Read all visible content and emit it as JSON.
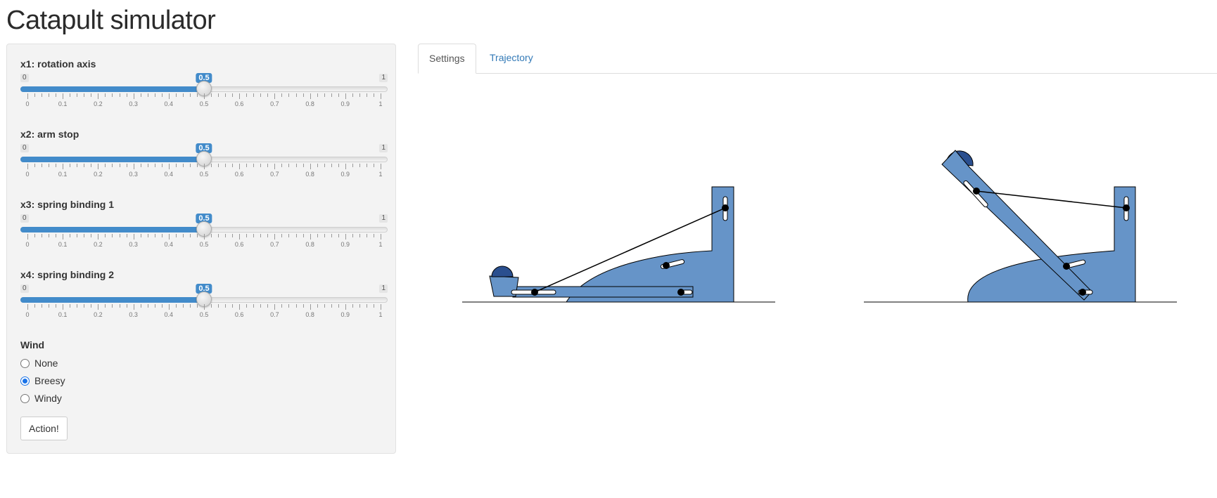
{
  "title": "Catapult simulator",
  "sliders": [
    {
      "label": "x1: rotation axis",
      "min": "0",
      "max": "1",
      "value": "0.5",
      "fraction": 0.5
    },
    {
      "label": "x2: arm stop",
      "min": "0",
      "max": "1",
      "value": "0.5",
      "fraction": 0.5
    },
    {
      "label": "x3: spring binding 1",
      "min": "0",
      "max": "1",
      "value": "0.5",
      "fraction": 0.5
    },
    {
      "label": "x4: spring binding 2",
      "min": "0",
      "max": "1",
      "value": "0.5",
      "fraction": 0.5
    }
  ],
  "ticks": [
    "0",
    "0.1",
    "0.2",
    "0.3",
    "0.4",
    "0.5",
    "0.6",
    "0.7",
    "0.8",
    "0.9",
    "1"
  ],
  "wind": {
    "label": "Wind",
    "options": [
      "None",
      "Breesy",
      "Windy"
    ],
    "selected": "Breesy"
  },
  "action_label": "Action!",
  "tabs": [
    "Settings",
    "Trajectory"
  ],
  "active_tab": "Settings",
  "colors": {
    "accent": "#428bca",
    "catapult_fill": "#6694c8",
    "ball_fill": "#2a4f8f",
    "link": "#337ab7"
  }
}
